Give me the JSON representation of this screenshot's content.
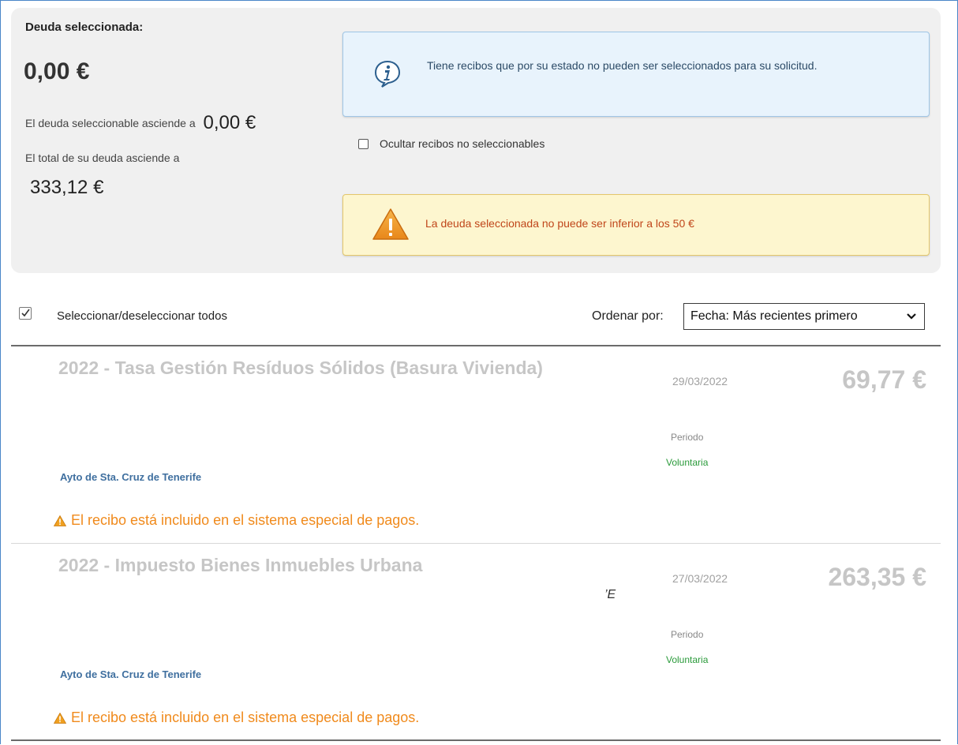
{
  "summary": {
    "selected_label": "Deuda seleccionada:",
    "selected_amount": "0,00 €",
    "selectable_label": "El deuda seleccionable asciende a",
    "selectable_amount": "0,00 €",
    "total_label": "El total de su deuda asciende a",
    "total_amount": "333,12 €"
  },
  "info_notice": {
    "icon": "info-icon",
    "text": "Tiene recibos que por su estado no pueden ser seleccionados para su solicitud."
  },
  "hide_filter": {
    "label": "Ocultar recibos no seleccionables",
    "checked": false
  },
  "warning_notice": {
    "icon": "warning-icon",
    "text": "La deuda seleccionada no puede ser inferior a los 50 €"
  },
  "list_controls": {
    "select_all_label": "Seleccionar/deseleccionar todos",
    "select_all_checked": true,
    "order_label": "Ordenar por:",
    "order_selected": "Fecha: Más recientes primero"
  },
  "receipts": [
    {
      "title": "2022 - Tasa Gestión Resíduos Sólidos (Basura Vivienda)",
      "date": "29/03/2022",
      "amount": "69,77 €",
      "period_label": "Periodo",
      "period_type": "Voluntaria",
      "entity": "Ayto de Sta. Cruz de Tenerife",
      "alert": "El recibo está incluido en el sistema especial de pagos."
    },
    {
      "title": "2022 - Impuesto Bienes Inmuebles Urbana",
      "date": "27/03/2022",
      "amount": "263,35 €",
      "period_label": "Periodo",
      "period_type": "Voluntaria",
      "entity": "Ayto de Sta. Cruz de Tenerife",
      "alert": "El recibo está incluido en el sistema especial de pagos.",
      "stray_text": "’E"
    }
  ],
  "colors": {
    "accent_blue": "#4a86c8",
    "info_bg": "#e8f3fc",
    "warn_bg": "#fdf6cf",
    "warn_text": "#c0461a",
    "alert_orange": "#f08a1c",
    "period_green": "#2a9a3a",
    "entity_blue": "#3f6f9f"
  }
}
